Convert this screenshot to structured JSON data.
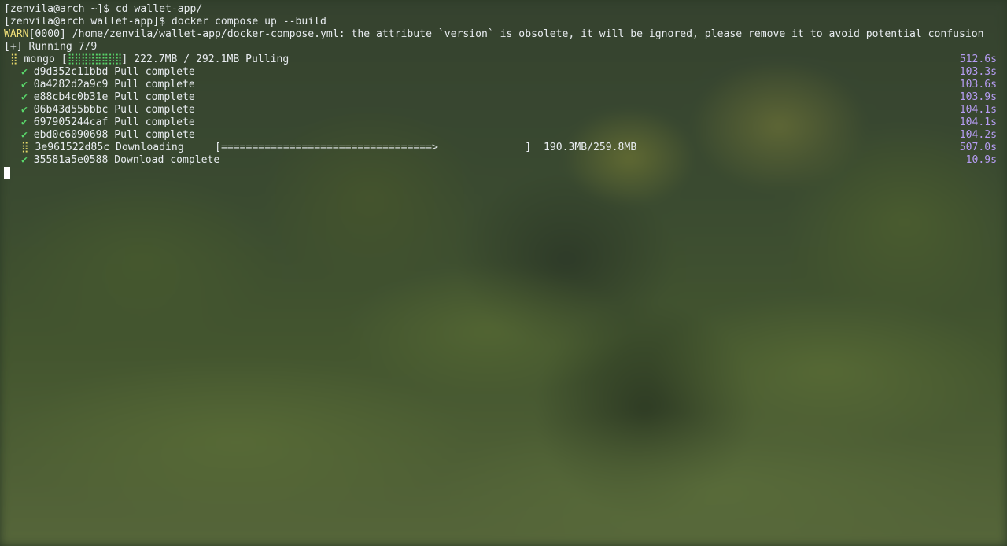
{
  "terminal": {
    "lines": [
      {
        "text": "[zenvila@arch ~]$ cd wallet-app/"
      },
      {
        "text": "[zenvila@arch wallet-app]$ docker compose up --build"
      },
      {
        "warn_tag": "WARN",
        "text": "[0000] /home/zenvila/wallet-app/docker-compose.yml: the attribute `version` is obsolete, it will be ignored, please remove it to avoid potential confusion"
      },
      {
        "text": "[+] Running 7/9"
      }
    ],
    "mongo": {
      "icon": "⣿",
      "name": "mongo",
      "bar_open": "[",
      "bar": "⣿⣿⣿⣿⣿⣿⣿⣿",
      "bar_close": "]",
      "progress": "222.7MB / 292.1MB",
      "status": "Pulling",
      "elapsed": "512.6s"
    },
    "layers": [
      {
        "icon": "✔",
        "id": "d9d352c11bbd",
        "status": "Pull complete",
        "elapsed": "103.3s"
      },
      {
        "icon": "✔",
        "id": "0a4282d2a9c9",
        "status": "Pull complete",
        "elapsed": "103.6s"
      },
      {
        "icon": "✔",
        "id": "e88cb4c0b31e",
        "status": "Pull complete",
        "elapsed": "103.9s"
      },
      {
        "icon": "✔",
        "id": "06b43d55bbbc",
        "status": "Pull complete",
        "elapsed": "104.1s"
      },
      {
        "icon": "✔",
        "id": "697905244caf",
        "status": "Pull complete",
        "elapsed": "104.1s"
      },
      {
        "icon": "✔",
        "id": "ebd0c6090698",
        "status": "Pull complete",
        "elapsed": "104.2s"
      }
    ],
    "downloading": {
      "icon": "⣿",
      "id": "3e961522d85c",
      "status": "Downloading",
      "bar": "[==================================>              ]",
      "progress": "190.3MB/259.8MB",
      "elapsed": "507.0s"
    },
    "download_done": {
      "icon": "✔",
      "id": "35581a5e0588",
      "status": "Download complete",
      "elapsed": "10.9s"
    }
  },
  "colors": {
    "text": "#e8ecf0",
    "warn": "#f3e27a",
    "success": "#59d86b",
    "elapsed": "#b59cf2"
  },
  "icons": [
    "check-icon",
    "spinner-icon"
  ]
}
